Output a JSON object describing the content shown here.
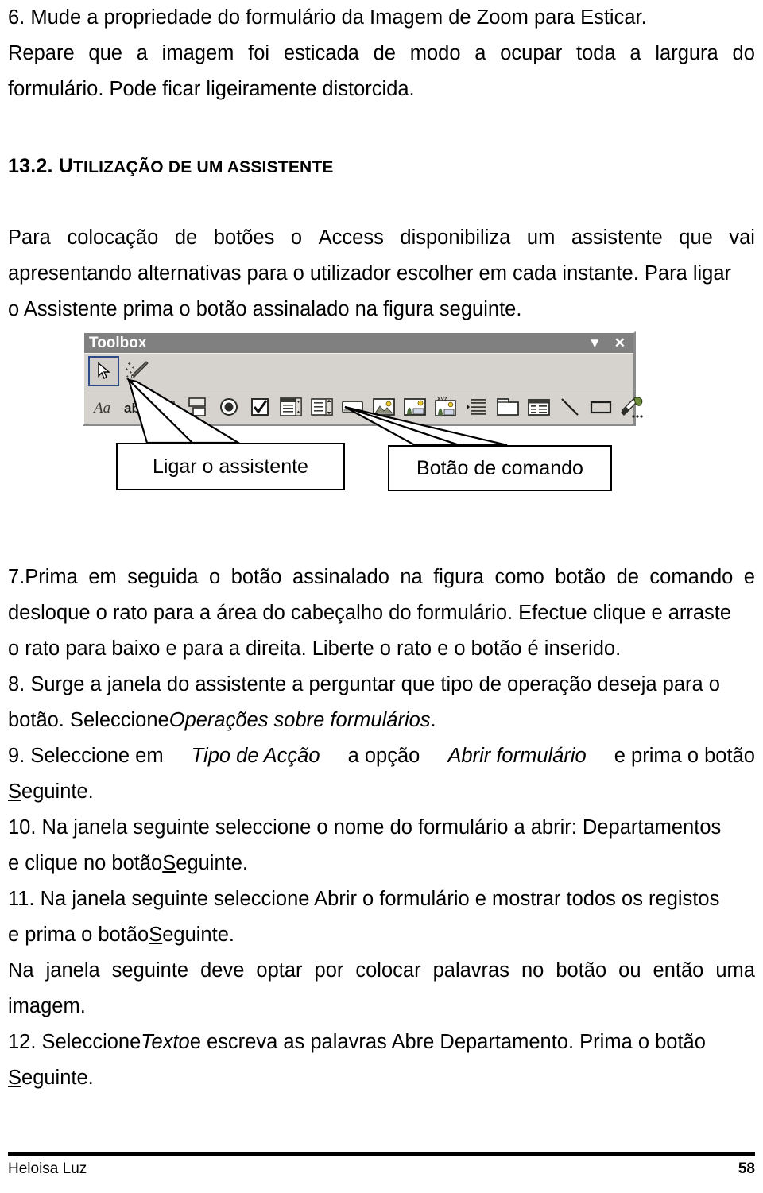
{
  "document": {
    "language": "pt-PT",
    "paragraphs": {
      "p6": {
        "line1": "6. Mude a propriedade do formulário da Imagem de Zoom para Esticar.",
        "line2_words": [
          "Repare",
          "que",
          "a",
          "imagem",
          "foi",
          "esticada",
          "de",
          "modo",
          "a",
          "ocupar",
          "toda",
          "a",
          "largura",
          "do"
        ],
        "line3": "formulário. Pode ficar ligeiramente distorcida."
      },
      "heading_13_2": {
        "number": "13.2.",
        "title": "Utilização de um assistente",
        "title_cap": "U",
        "title_rest": "tilização de um assistente"
      },
      "p_intro": {
        "line1_words": [
          "Para",
          "colocação",
          "de",
          "botões",
          "o",
          "Access",
          "disponibiliza",
          "um",
          "assistente",
          "que",
          "vai"
        ],
        "line2": "apresentando alternativas para o utilizador escolher em cada instante. Para ligar",
        "line3": "o Assistente prima o botão assinalado na figura seguinte."
      },
      "p7": {
        "line1_words": [
          "7.Prima",
          "em",
          "seguida",
          "o",
          "botão",
          "assinalado",
          "na",
          "figura",
          "como",
          "botão",
          "de",
          "comando",
          "e"
        ],
        "line2": "desloque o rato para a área do cabeçalho do formulário. Efectue clique e arraste",
        "line3": "o rato para baixo e para a direita. Liberte o rato e o botão é inserido."
      },
      "p8": {
        "line1": "8. Surge a janela do assistente a perguntar que tipo de operação deseja para o",
        "line2_pre": "botão. Seleccione ",
        "line2_italic": "Operações sobre formulários",
        "line2_post": "."
      },
      "p9": {
        "line1_a": "9. Seleccione em",
        "line1_b": "Tipo de Acção",
        "line1_c": "a opção",
        "line1_d": "Abrir formulário",
        "line1_e": "e prima o botão",
        "line2_mnemonic": "S",
        "line2_rest": "eguinte."
      },
      "p10": {
        "line1": "10. Na janela seguinte seleccione o nome do formulário a abrir: Departamentos",
        "line2_pre": "e clique no botão ",
        "line2_mnemonic": "S",
        "line2_rest": "eguinte."
      },
      "p11": {
        "line1": "11. Na janela seguinte seleccione Abrir o formulário e mostrar todos os registos",
        "line2_pre": "e prima o botão ",
        "line2_mnemonic": "S",
        "line2_rest": "eguinte."
      },
      "p_na_janela": {
        "line1_words": [
          "Na",
          "janela",
          "seguinte",
          "deve",
          "optar",
          "por",
          "colocar",
          "palavras",
          "no",
          "botão",
          "ou",
          "então",
          "uma"
        ],
        "line2": "imagem."
      },
      "p12": {
        "line1_pre": "12. Seleccione ",
        "line1_italic": "Texto",
        "line1_post": " e escreva as palavras Abre Departamento. Prima o botão",
        "line2_mnemonic": "S",
        "line2_rest": "eguinte."
      }
    },
    "footer": {
      "author": "Heloisa Luz",
      "page_number": "58"
    }
  },
  "figure": {
    "toolbox": {
      "title": "Toolbox",
      "title_bar_color": "#808080",
      "face_color": "#d6d3ce",
      "title_buttons": [
        {
          "name": "dropdown-arrow",
          "glyph": "▼"
        },
        {
          "name": "close",
          "glyph": "✕"
        }
      ],
      "row1_tools": [
        {
          "name": "select-objects",
          "label": "Select Objects",
          "selected": true
        },
        {
          "name": "control-wizards",
          "label": "Control Wizards",
          "selected": false
        }
      ],
      "row2_tools": [
        {
          "name": "label",
          "label": "Label"
        },
        {
          "name": "text-box",
          "label": "Text Box"
        },
        {
          "name": "option-group",
          "label": "Option Group"
        },
        {
          "name": "toggle-button",
          "label": "Toggle Button"
        },
        {
          "name": "option-button",
          "label": "Option Button"
        },
        {
          "name": "check-box",
          "label": "Check Box"
        },
        {
          "name": "combo-box",
          "label": "Combo Box"
        },
        {
          "name": "list-box",
          "label": "List Box"
        },
        {
          "name": "command-button",
          "label": "Command Button"
        },
        {
          "name": "image",
          "label": "Image"
        },
        {
          "name": "unbound-object-frame",
          "label": "Unbound Object Frame"
        },
        {
          "name": "bound-object-frame",
          "label": "Bound Object Frame"
        },
        {
          "name": "page-break",
          "label": "Page Break"
        },
        {
          "name": "tab-control",
          "label": "Tab Control"
        },
        {
          "name": "subform-subreport",
          "label": "Subform/Subreport"
        },
        {
          "name": "line",
          "label": "Line"
        },
        {
          "name": "rectangle",
          "label": "Rectangle"
        },
        {
          "name": "more-controls",
          "label": "More Controls"
        }
      ]
    },
    "callouts": [
      {
        "id": "left",
        "text": "Ligar o assistente",
        "points_to": "control-wizards"
      },
      {
        "id": "right",
        "text": "Botão de comando",
        "points_to": "command-button"
      }
    ]
  }
}
